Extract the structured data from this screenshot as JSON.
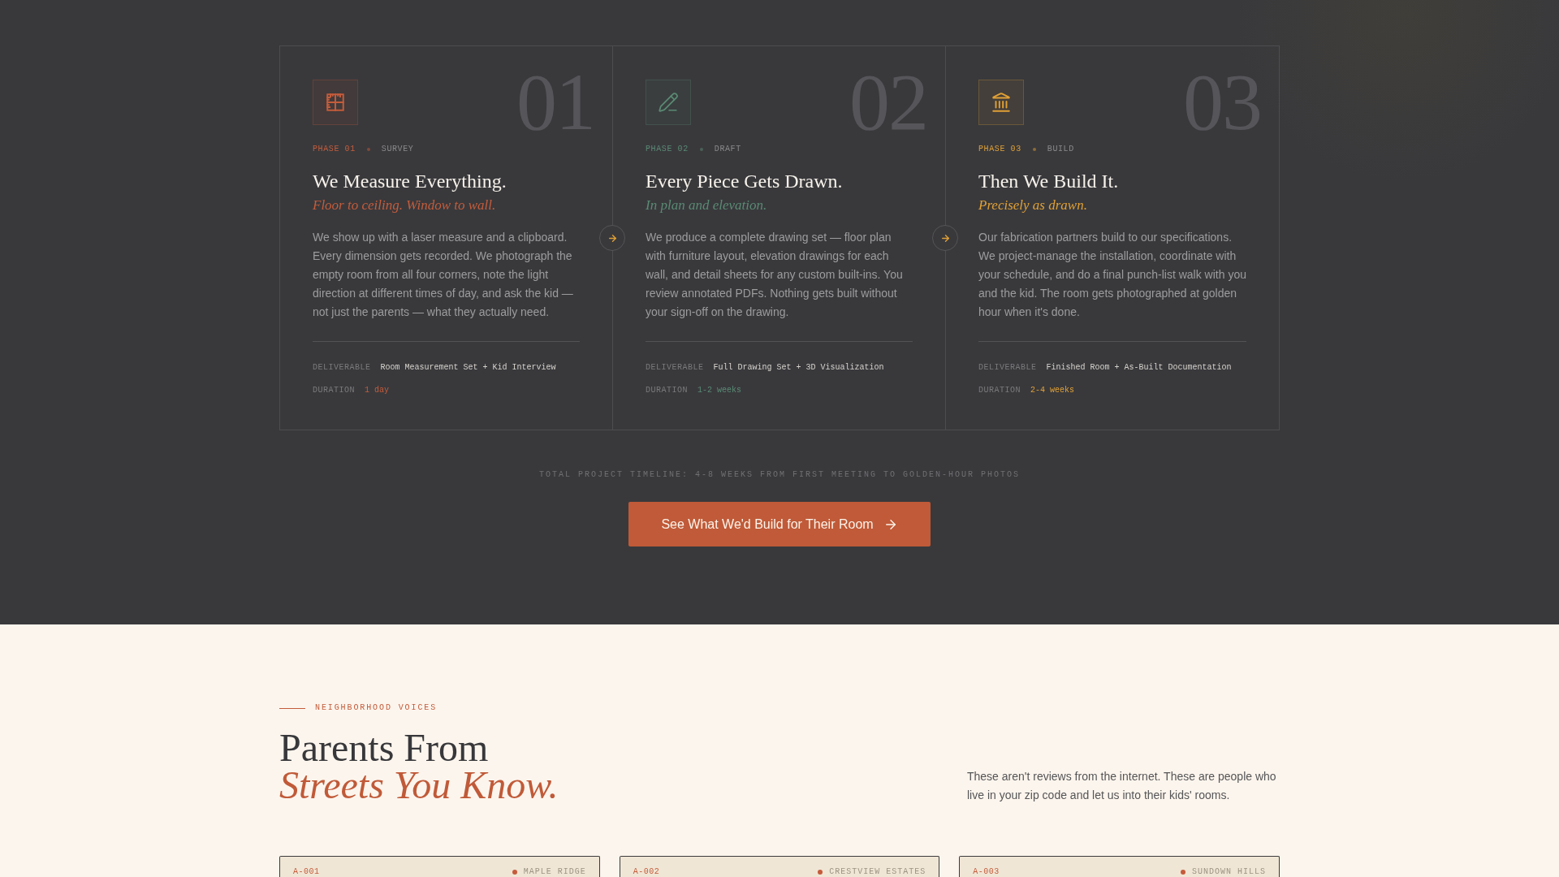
{
  "process": {
    "phases": [
      {
        "number": "01",
        "phase_label": "PHASE 01",
        "stage": "SURVEY",
        "title": "We Measure Everything.",
        "tagline": "Floor to ceiling. Window to wall.",
        "body": "We show up with a laser measure and a clipboard. Every dimension gets recorded. We photograph the empty room from all four corners, note the light direction at different times of day, and ask the kid — not just the parents — what they actually need.",
        "deliverable_label": "DELIVERABLE",
        "deliverable": "Room Measurement Set + Kid Interview",
        "duration_label": "DURATION",
        "duration": "1 day",
        "color": "#c45c3b"
      },
      {
        "number": "02",
        "phase_label": "PHASE 02",
        "stage": "DRAFT",
        "title": "Every Piece Gets Drawn.",
        "tagline": "In plan and elevation.",
        "body": "We produce a complete drawing set — floor plan with furniture layout, elevation drawings for each wall, and detail sheets for any custom built-ins. You review annotated PDFs. Nothing gets built without your sign-off on the drawing.",
        "deliverable_label": "DELIVERABLE",
        "deliverable": "Full Drawing Set + 3D Visualization",
        "duration_label": "DURATION",
        "duration": "1-2 weeks",
        "color": "#5a8a74"
      },
      {
        "number": "03",
        "phase_label": "PHASE 03",
        "stage": "BUILD",
        "title": "Then We Build It.",
        "tagline": "Precisely as drawn.",
        "body": "Our fabrication partners build to our specifications. We project-manage the installation, coordinate with your schedule, and do a final punch-list walk with you and the kid. The room gets photographed at golden hour when it's done.",
        "deliverable_label": "DELIVERABLE",
        "deliverable": "Finished Room + As-Built Documentation",
        "duration_label": "DURATION",
        "duration": "2-4 weeks",
        "color": "#e0a035"
      }
    ],
    "timeline_note": "TOTAL PROJECT TIMELINE: 4-8 WEEKS FROM FIRST MEETING TO GOLDEN-HOUR PHOTOS",
    "cta": {
      "label": "See What We'd Build for Their Room"
    }
  },
  "testimonials": {
    "eyebrow": "NEIGHBORHOOD VOICES",
    "heading_line_1": "Parents From",
    "heading_line_2": "Streets You Know.",
    "intro": "These aren't reviews from the internet. These are people who live in your zip code and let us into their kids' rooms.",
    "cards": [
      {
        "code": "A-001",
        "neighborhood": "MAPLE RIDGE"
      },
      {
        "code": "A-002",
        "neighborhood": "CRESTVIEW ESTATES"
      },
      {
        "code": "A-003",
        "neighborhood": "SUNDOWN HILLS"
      }
    ]
  }
}
